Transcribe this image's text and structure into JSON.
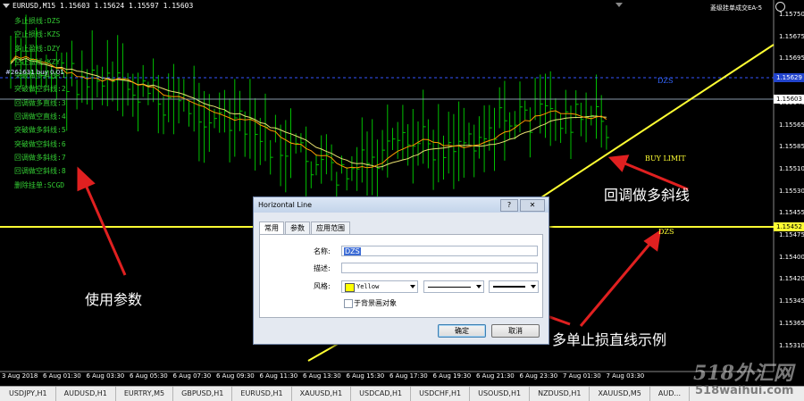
{
  "chart": {
    "header": "EURUSD,M15  1.15603 1.15624 1.15597 1.15603",
    "ea_label": "菱级挂单成交EA-5",
    "order_label": "#261631 buy 0.01",
    "params": [
      "多止损线:DZS",
      "空止损线:KZS",
      "多止盈线:DZY",
      "空止盈线:KZY",
      "突破做多斜线:1",
      "突破做空斜线:2",
      "回调做多直线:3",
      "回调做空直线:4",
      "突破做多斜线:5",
      "突破做空斜线:6",
      "回调做多斜线:7",
      "回调做空斜线:8",
      "删除挂单:SCGD"
    ],
    "price_axis": [
      "1.15750",
      "1.15695",
      "1.15640",
      "1.15585",
      "1.15530",
      "1.15475",
      "1.15420",
      "1.15365",
      "1.15310"
    ],
    "price_axis_extra": [
      "1.15675",
      "1.15620",
      "1.15565",
      "1.15510",
      "1.15455",
      "1.15400",
      "1.15345"
    ],
    "price_tags": {
      "blue": "1.15629",
      "current": "1.15603",
      "yellow": "1.15452"
    },
    "time_axis": [
      "3 Aug 2018",
      "6 Aug 01:30",
      "6 Aug 03:30",
      "6 Aug 05:30",
      "6 Aug 07:30",
      "6 Aug 09:30",
      "6 Aug 11:30",
      "6 Aug 13:30",
      "6 Aug 15:30",
      "6 Aug 17:30",
      "6 Aug 19:30",
      "6 Aug 21:30",
      "6 Aug 23:30",
      "7 Aug 01:30",
      "7 Aug 03:30"
    ],
    "buy_limit": "BUY LIMIT",
    "dzs_yellow": "DZS",
    "dzs_blue": "DZS",
    "colors": {
      "background": "#000000",
      "bars": "#00cc00",
      "ma_fast": "#ff9900",
      "ma_slow": "#ffff66",
      "trend": "#ffff33",
      "hline": "#ffff33"
    }
  },
  "annotations": {
    "use_params": "使用参数",
    "pullback_long": "回调做多斜线",
    "multi_stop": "多单止损直线示例"
  },
  "dialog": {
    "title": "Horizontal Line",
    "help": "?",
    "close": "✕",
    "tabs": [
      "常用",
      "参数",
      "应用范围"
    ],
    "name_label": "名称:",
    "name_value": "DZS",
    "desc_label": "描述:",
    "desc_value": "",
    "style_label": "风格:",
    "color_value": "Yellow",
    "bg_checkbox": "于背景画对象",
    "ok": "确定",
    "cancel": "取消"
  },
  "tabs": [
    "USDJPY,H1",
    "AUDUSD,H1",
    "EURTRY,M5",
    "GBPUSD,H1",
    "EURUSD,H1",
    "XAUUSD,H1",
    "USDCAD,H1",
    "USDCHF,H1",
    "USOUSD,H1",
    "NZDUSD,H1",
    "XAUUSD,M5",
    "AUD..."
  ],
  "watermark": {
    "line1": "518外汇网",
    "line2": "518waihui.com"
  }
}
